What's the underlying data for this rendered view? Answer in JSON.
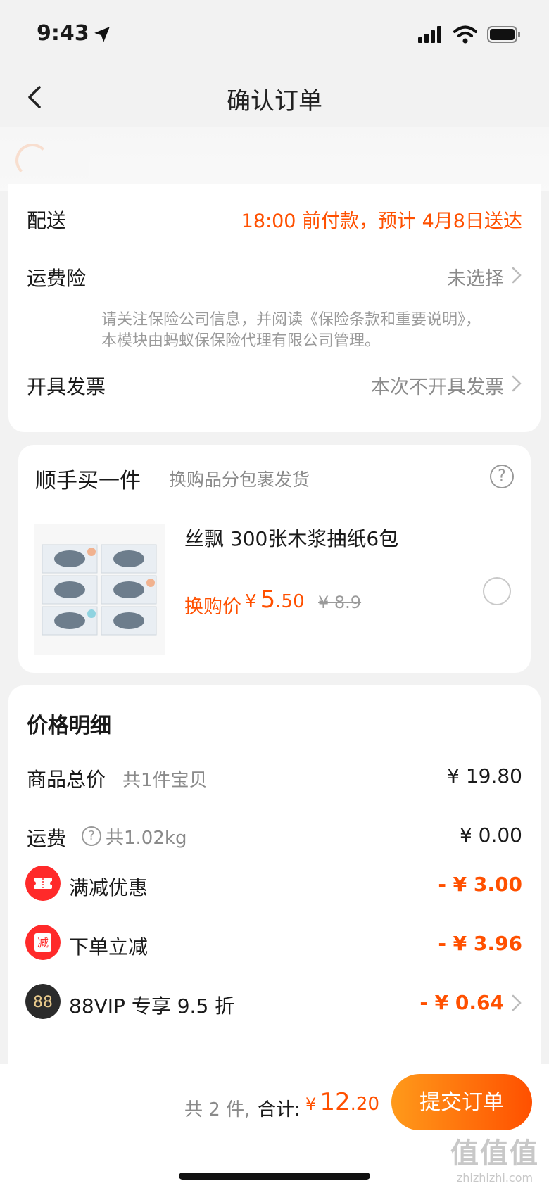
{
  "status_bar": {
    "time": "9:43"
  },
  "nav": {
    "title": "确认订单"
  },
  "delivery": {
    "label": "配送",
    "value": "18:00 前付款，预计 4月8日送达"
  },
  "shipping_insurance": {
    "label": "运费险",
    "value": "未选择",
    "note": "请关注保险公司信息，并阅读《保险条款和重要说明》，本模块由蚂蚁保保险代理有限公司管理。"
  },
  "invoice": {
    "label": "开具发票",
    "value": "本次不开具发票"
  },
  "addon": {
    "title": "顺手买一件",
    "subtitle": "换购品分包裹发货",
    "help": "?",
    "product_name": "丝飘 300张木浆抽纸6包",
    "price_label": "换购价",
    "currency": "¥",
    "price_int": "5",
    "price_dec": ".50",
    "original_price": "¥ 8.9"
  },
  "price_detail": {
    "title": "价格明细",
    "items_total": {
      "label": "商品总价",
      "sub": "共1件宝贝",
      "value": "¥ 19.80"
    },
    "shipping": {
      "label": "运费",
      "help": "?",
      "sub": "共1.02kg",
      "value": "¥ 0.00"
    },
    "full_reduction": {
      "label": "满减优惠",
      "value": "- ¥ 3.00",
      "color": "#ff2a2a"
    },
    "order_discount": {
      "label": "下单立减",
      "badge": "减",
      "value": "- ¥ 3.96",
      "color": "#ff2a2a"
    },
    "vip": {
      "badge": "88",
      "label": "88VIP 专享 9.5 折",
      "value": "- ¥ 0.64",
      "color": "#2b2b2b"
    }
  },
  "bottom": {
    "count": "共 2 件,",
    "total_label": "合计:",
    "currency": "¥",
    "total_int": "12",
    "total_dec": ".20",
    "submit": "提交订单",
    "watermark_big": "值值值",
    "watermark_small": "zhizhizhi.com"
  },
  "colors": {
    "accent": "#ff5000"
  }
}
